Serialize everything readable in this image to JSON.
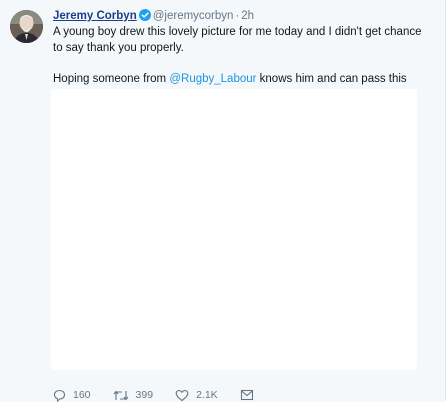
{
  "tweet": {
    "author_name": "Jeremy Corbyn",
    "author_handle": "@jeremycorbyn",
    "separator": "·",
    "timestamp": "2h",
    "verified_icon": "verified-badge-icon",
    "text_line_1": "A young boy drew this lovely picture for me today and I didn't get chance to say thank you properly.",
    "text_line_2_before": "Hoping someone from ",
    "text_line_2_mention": "@Rugby_Labour",
    "text_line_2_after": " knows him and can pass this on."
  },
  "actions": {
    "reply_count": "160",
    "retweet_count": "399",
    "like_count": "2.1K",
    "reply_icon": "reply-icon",
    "retweet_icon": "retweet-icon",
    "like_icon": "heart-icon",
    "dm_icon": "envelope-icon"
  },
  "colors": {
    "name": "#1b3e8a",
    "mention": "#1b95e0",
    "muted": "#657786",
    "background": "#f5f8fa"
  }
}
